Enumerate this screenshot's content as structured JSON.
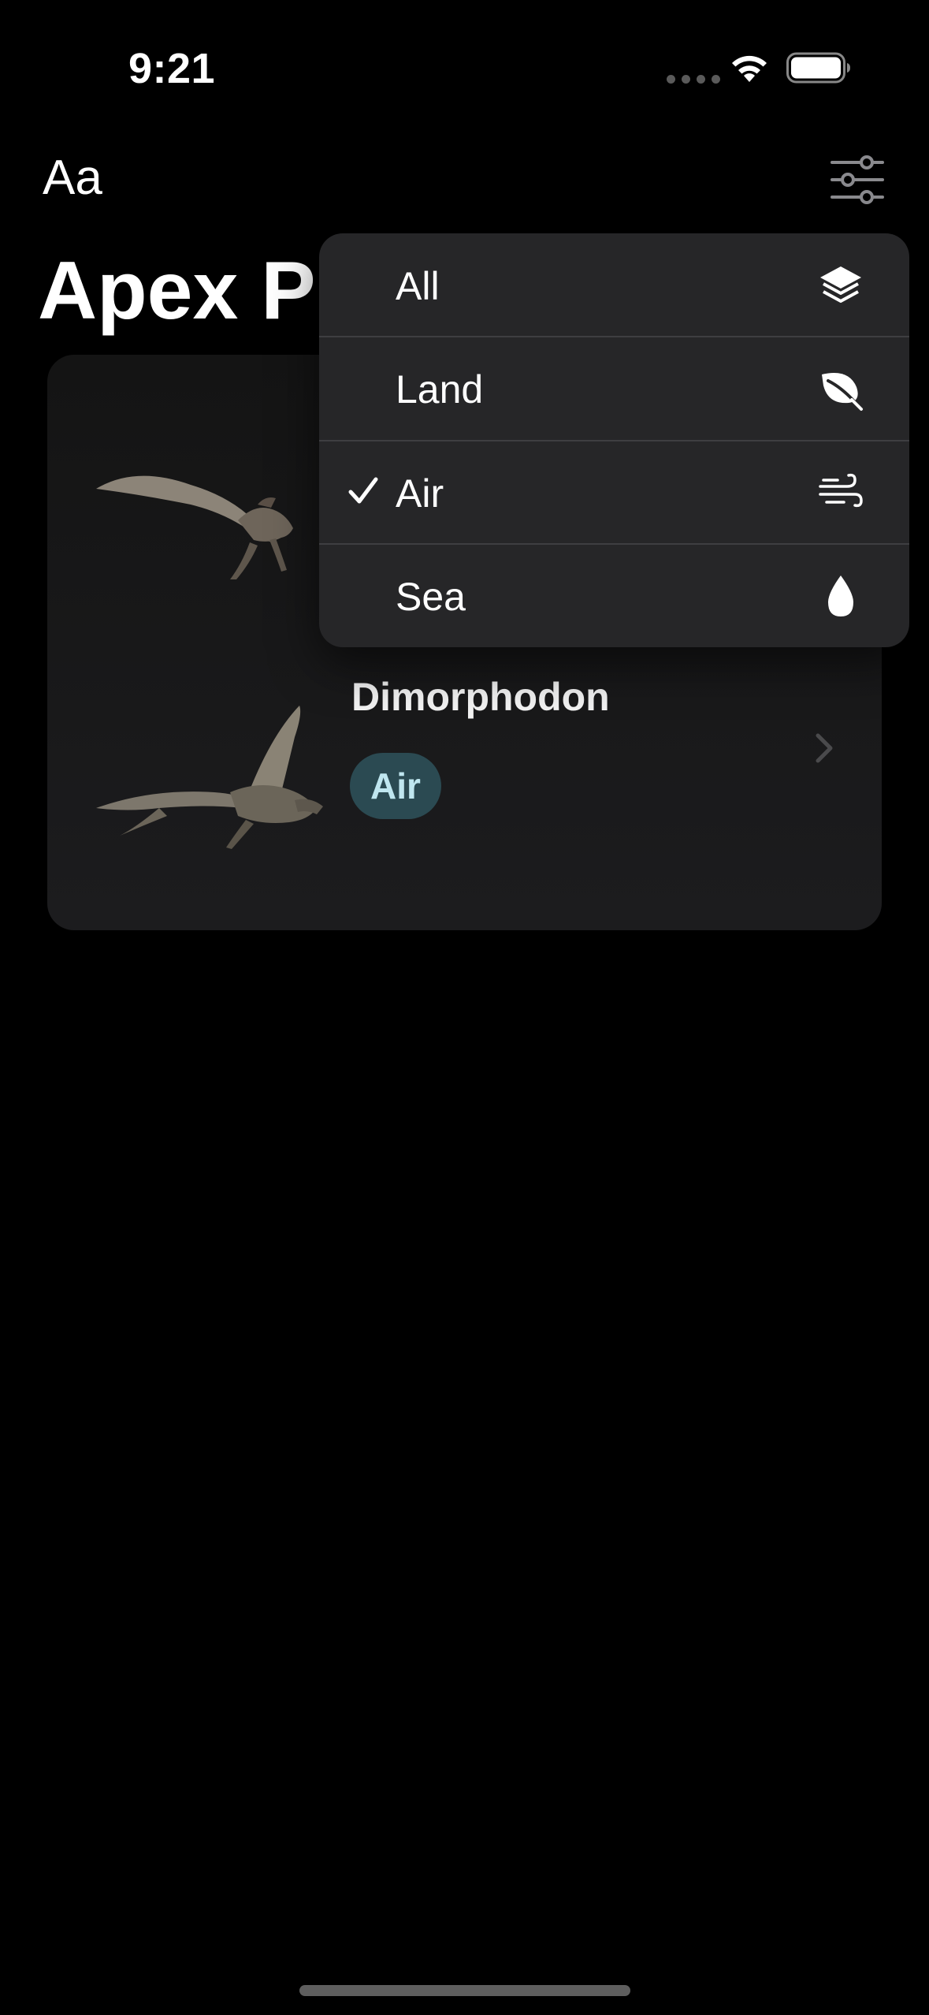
{
  "status_bar": {
    "time": "9:21"
  },
  "header": {
    "text_size_label": "Aa",
    "title": "Apex Pr",
    "filter_icon": "sliders-icon"
  },
  "list": {
    "rows": [
      {
        "name": "",
        "badge": "",
        "image": "pteranodon-image"
      },
      {
        "name": "Dimorphodon",
        "badge": "Air",
        "image": "dimorphodon-image"
      }
    ]
  },
  "menu": {
    "items": [
      {
        "label": "All",
        "icon": "layers-icon",
        "selected": false
      },
      {
        "label": "Land",
        "icon": "leaf-icon",
        "selected": false
      },
      {
        "label": "Air",
        "icon": "wind-icon",
        "selected": true
      },
      {
        "label": "Sea",
        "icon": "drop-icon",
        "selected": false
      }
    ]
  },
  "colors": {
    "background": "#000000",
    "card": "#1c1c1e",
    "menu": "#262628",
    "badge_bg": "#2b4a52",
    "badge_text": "#bfe6ef"
  }
}
